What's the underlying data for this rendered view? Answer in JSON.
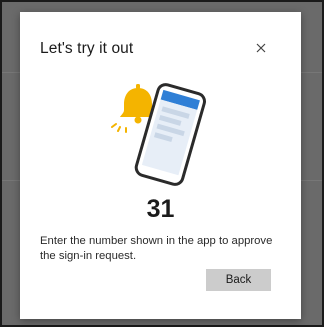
{
  "dialog": {
    "title": "Let's try it out",
    "close_icon": "close-icon",
    "illustration_icon": "phone-notification-bell-icon",
    "number": "31",
    "message": "Enter the number shown in the app to approve the sign-in request.",
    "back_label": "Back"
  },
  "colors": {
    "overlay": "#6a6a6a",
    "dialog_bg": "#ffffff",
    "bell": "#f4b400",
    "phone_header": "#2f7fd6",
    "button_bg": "#cccccc"
  }
}
